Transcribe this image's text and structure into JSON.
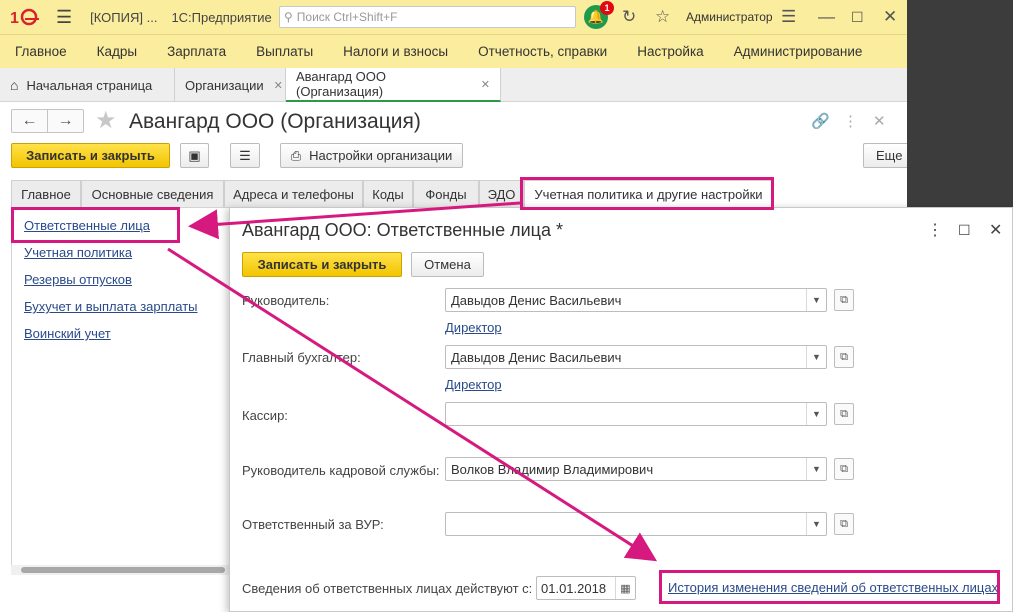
{
  "titlebar": {
    "window_title": "[КОПИЯ] ...",
    "app_name": "1С:Предприятие",
    "search_placeholder": "Поиск Ctrl+Shift+F",
    "notifications_count": "1",
    "user": "Администратор"
  },
  "menu": [
    "Главное",
    "Кадры",
    "Зарплата",
    "Выплаты",
    "Налоги и взносы",
    "Отчетность, справки",
    "Настройка",
    "Администрирование"
  ],
  "open_tabs": [
    {
      "label": "Начальная страница"
    },
    {
      "label": "Организации"
    },
    {
      "label": "Авангард ООО (Организация)"
    }
  ],
  "form": {
    "title": "Авангард ООО (Организация)",
    "save_close": "Записать и закрыть",
    "org_settings": "Настройки организации",
    "more": "Еще"
  },
  "section_tabs": [
    "Главное",
    "Основные сведения",
    "Адреса и телефоны",
    "Коды",
    "Фонды",
    "ЭДО",
    "Учетная политика и другие настройки"
  ],
  "left_nav": [
    "Ответственные лица",
    "Учетная политика",
    "Резервы отпусков",
    "Бухучет и выплата зарплаты",
    "Воинский учет"
  ],
  "modal": {
    "title": "Авангард ООО: Ответственные лица *",
    "save_close": "Записать и закрыть",
    "cancel": "Отмена",
    "fields": [
      {
        "label": "Руководитель:",
        "value": "Давыдов Денис Васильевич",
        "position": "Директор"
      },
      {
        "label": "Главный бухгалтер:",
        "value": "Давыдов Денис Васильевич",
        "position": "Директор"
      },
      {
        "label": "Кассир:",
        "value": "",
        "position": ""
      },
      {
        "label": "Руководитель кадровой службы:",
        "value": "Волков Владимир Владимирович",
        "position": ""
      },
      {
        "label": "Ответственный за ВУР:",
        "value": "",
        "position": ""
      }
    ],
    "effective_label": "Сведения об ответственных лицах действуют с:",
    "effective_date": "01.01.2018",
    "history_link": "История изменения сведений об ответственных лицах"
  },
  "colors": {
    "accent_yellow": "#fbed9e",
    "highlight": "#d6197f",
    "active_tab_green": "#2b9a46"
  }
}
